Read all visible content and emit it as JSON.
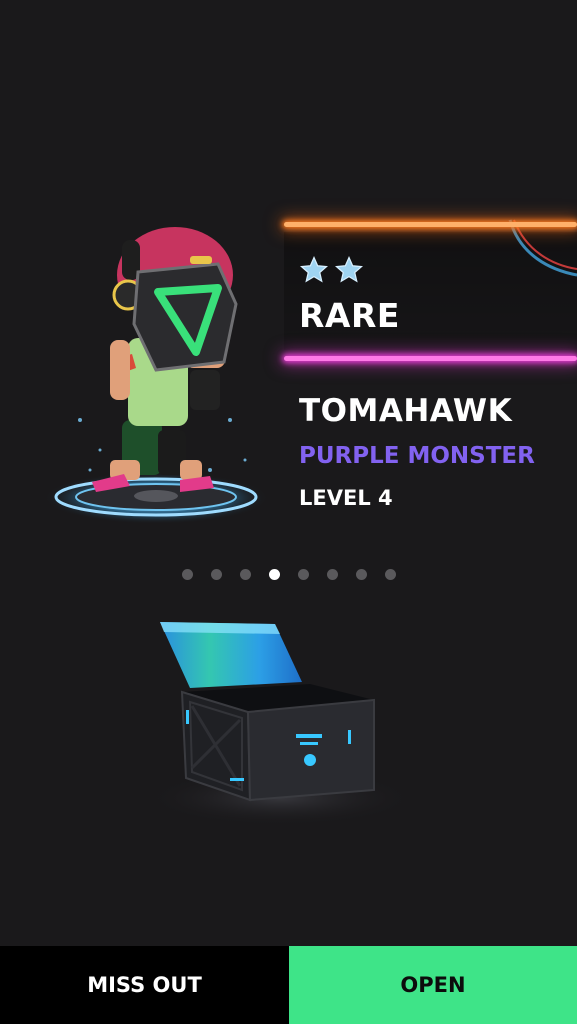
{
  "reward": {
    "stars": 2,
    "rarity": "RARE",
    "name": "TOMAHAWK",
    "subtitle": "PURPLE MONSTER",
    "level": "LEVEL 4"
  },
  "pagination": {
    "count": 8,
    "active_index": 3
  },
  "actions": {
    "miss_out_label": "MISS OUT",
    "open_label": "OPEN"
  },
  "colors": {
    "background": "#1a191b",
    "neon_orange": "#ff7a20",
    "neon_pink": "#e23bd0",
    "subtitle": "#8262f0",
    "open_button": "#3ee488",
    "miss_out_button": "#000000",
    "star": "#9fd4f2"
  },
  "icons": {
    "star": "star-icon",
    "character": "character-illustration",
    "chest": "treasure-chest-icon"
  }
}
